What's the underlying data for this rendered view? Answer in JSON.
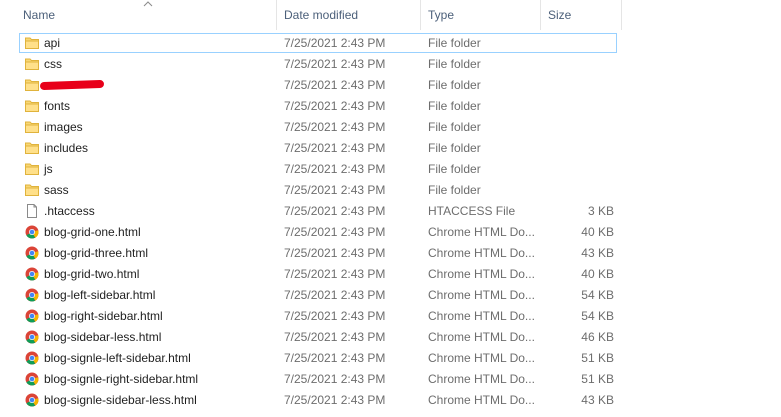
{
  "columns": {
    "name": "Name",
    "date": "Date modified",
    "type": "Type",
    "size": "Size"
  },
  "colors": {
    "folder": "#f8d775",
    "folder_dark": "#e0b33c",
    "selection_border": "#99d1ff",
    "redaction": "#e8001a"
  },
  "rows": [
    {
      "name": "api",
      "date": "7/25/2021 2:43 PM",
      "type": "File folder",
      "size": "",
      "icon": "folder-icon"
    },
    {
      "name": "css",
      "date": "7/25/2021 2:43 PM",
      "type": "File folder",
      "size": "",
      "icon": "folder-icon"
    },
    {
      "name": "",
      "date": "7/25/2021 2:43 PM",
      "type": "File folder",
      "size": "",
      "icon": "folder-icon",
      "redacted": true
    },
    {
      "name": "fonts",
      "date": "7/25/2021 2:43 PM",
      "type": "File folder",
      "size": "",
      "icon": "folder-icon"
    },
    {
      "name": "images",
      "date": "7/25/2021 2:43 PM",
      "type": "File folder",
      "size": "",
      "icon": "folder-icon"
    },
    {
      "name": "includes",
      "date": "7/25/2021 2:43 PM",
      "type": "File folder",
      "size": "",
      "icon": "folder-icon"
    },
    {
      "name": "js",
      "date": "7/25/2021 2:43 PM",
      "type": "File folder",
      "size": "",
      "icon": "folder-icon"
    },
    {
      "name": "sass",
      "date": "7/25/2021 2:43 PM",
      "type": "File folder",
      "size": "",
      "icon": "folder-icon"
    },
    {
      "name": ".htaccess",
      "date": "7/25/2021 2:43 PM",
      "type": "HTACCESS File",
      "size": "3 KB",
      "icon": "file-icon"
    },
    {
      "name": "blog-grid-one.html",
      "date": "7/25/2021 2:43 PM",
      "type": "Chrome HTML Do...",
      "size": "40 KB",
      "icon": "chrome-icon"
    },
    {
      "name": "blog-grid-three.html",
      "date": "7/25/2021 2:43 PM",
      "type": "Chrome HTML Do...",
      "size": "43 KB",
      "icon": "chrome-icon"
    },
    {
      "name": "blog-grid-two.html",
      "date": "7/25/2021 2:43 PM",
      "type": "Chrome HTML Do...",
      "size": "40 KB",
      "icon": "chrome-icon"
    },
    {
      "name": "blog-left-sidebar.html",
      "date": "7/25/2021 2:43 PM",
      "type": "Chrome HTML Do...",
      "size": "54 KB",
      "icon": "chrome-icon"
    },
    {
      "name": "blog-right-sidebar.html",
      "date": "7/25/2021 2:43 PM",
      "type": "Chrome HTML Do...",
      "size": "54 KB",
      "icon": "chrome-icon"
    },
    {
      "name": "blog-sidebar-less.html",
      "date": "7/25/2021 2:43 PM",
      "type": "Chrome HTML Do...",
      "size": "46 KB",
      "icon": "chrome-icon"
    },
    {
      "name": "blog-signle-left-sidebar.html",
      "date": "7/25/2021 2:43 PM",
      "type": "Chrome HTML Do...",
      "size": "51 KB",
      "icon": "chrome-icon"
    },
    {
      "name": "blog-signle-right-sidebar.html",
      "date": "7/25/2021 2:43 PM",
      "type": "Chrome HTML Do...",
      "size": "51 KB",
      "icon": "chrome-icon"
    },
    {
      "name": "blog-signle-sidebar-less.html",
      "date": "7/25/2021 2:43 PM",
      "type": "Chrome HTML Do...",
      "size": "43 KB",
      "icon": "chrome-icon"
    }
  ]
}
